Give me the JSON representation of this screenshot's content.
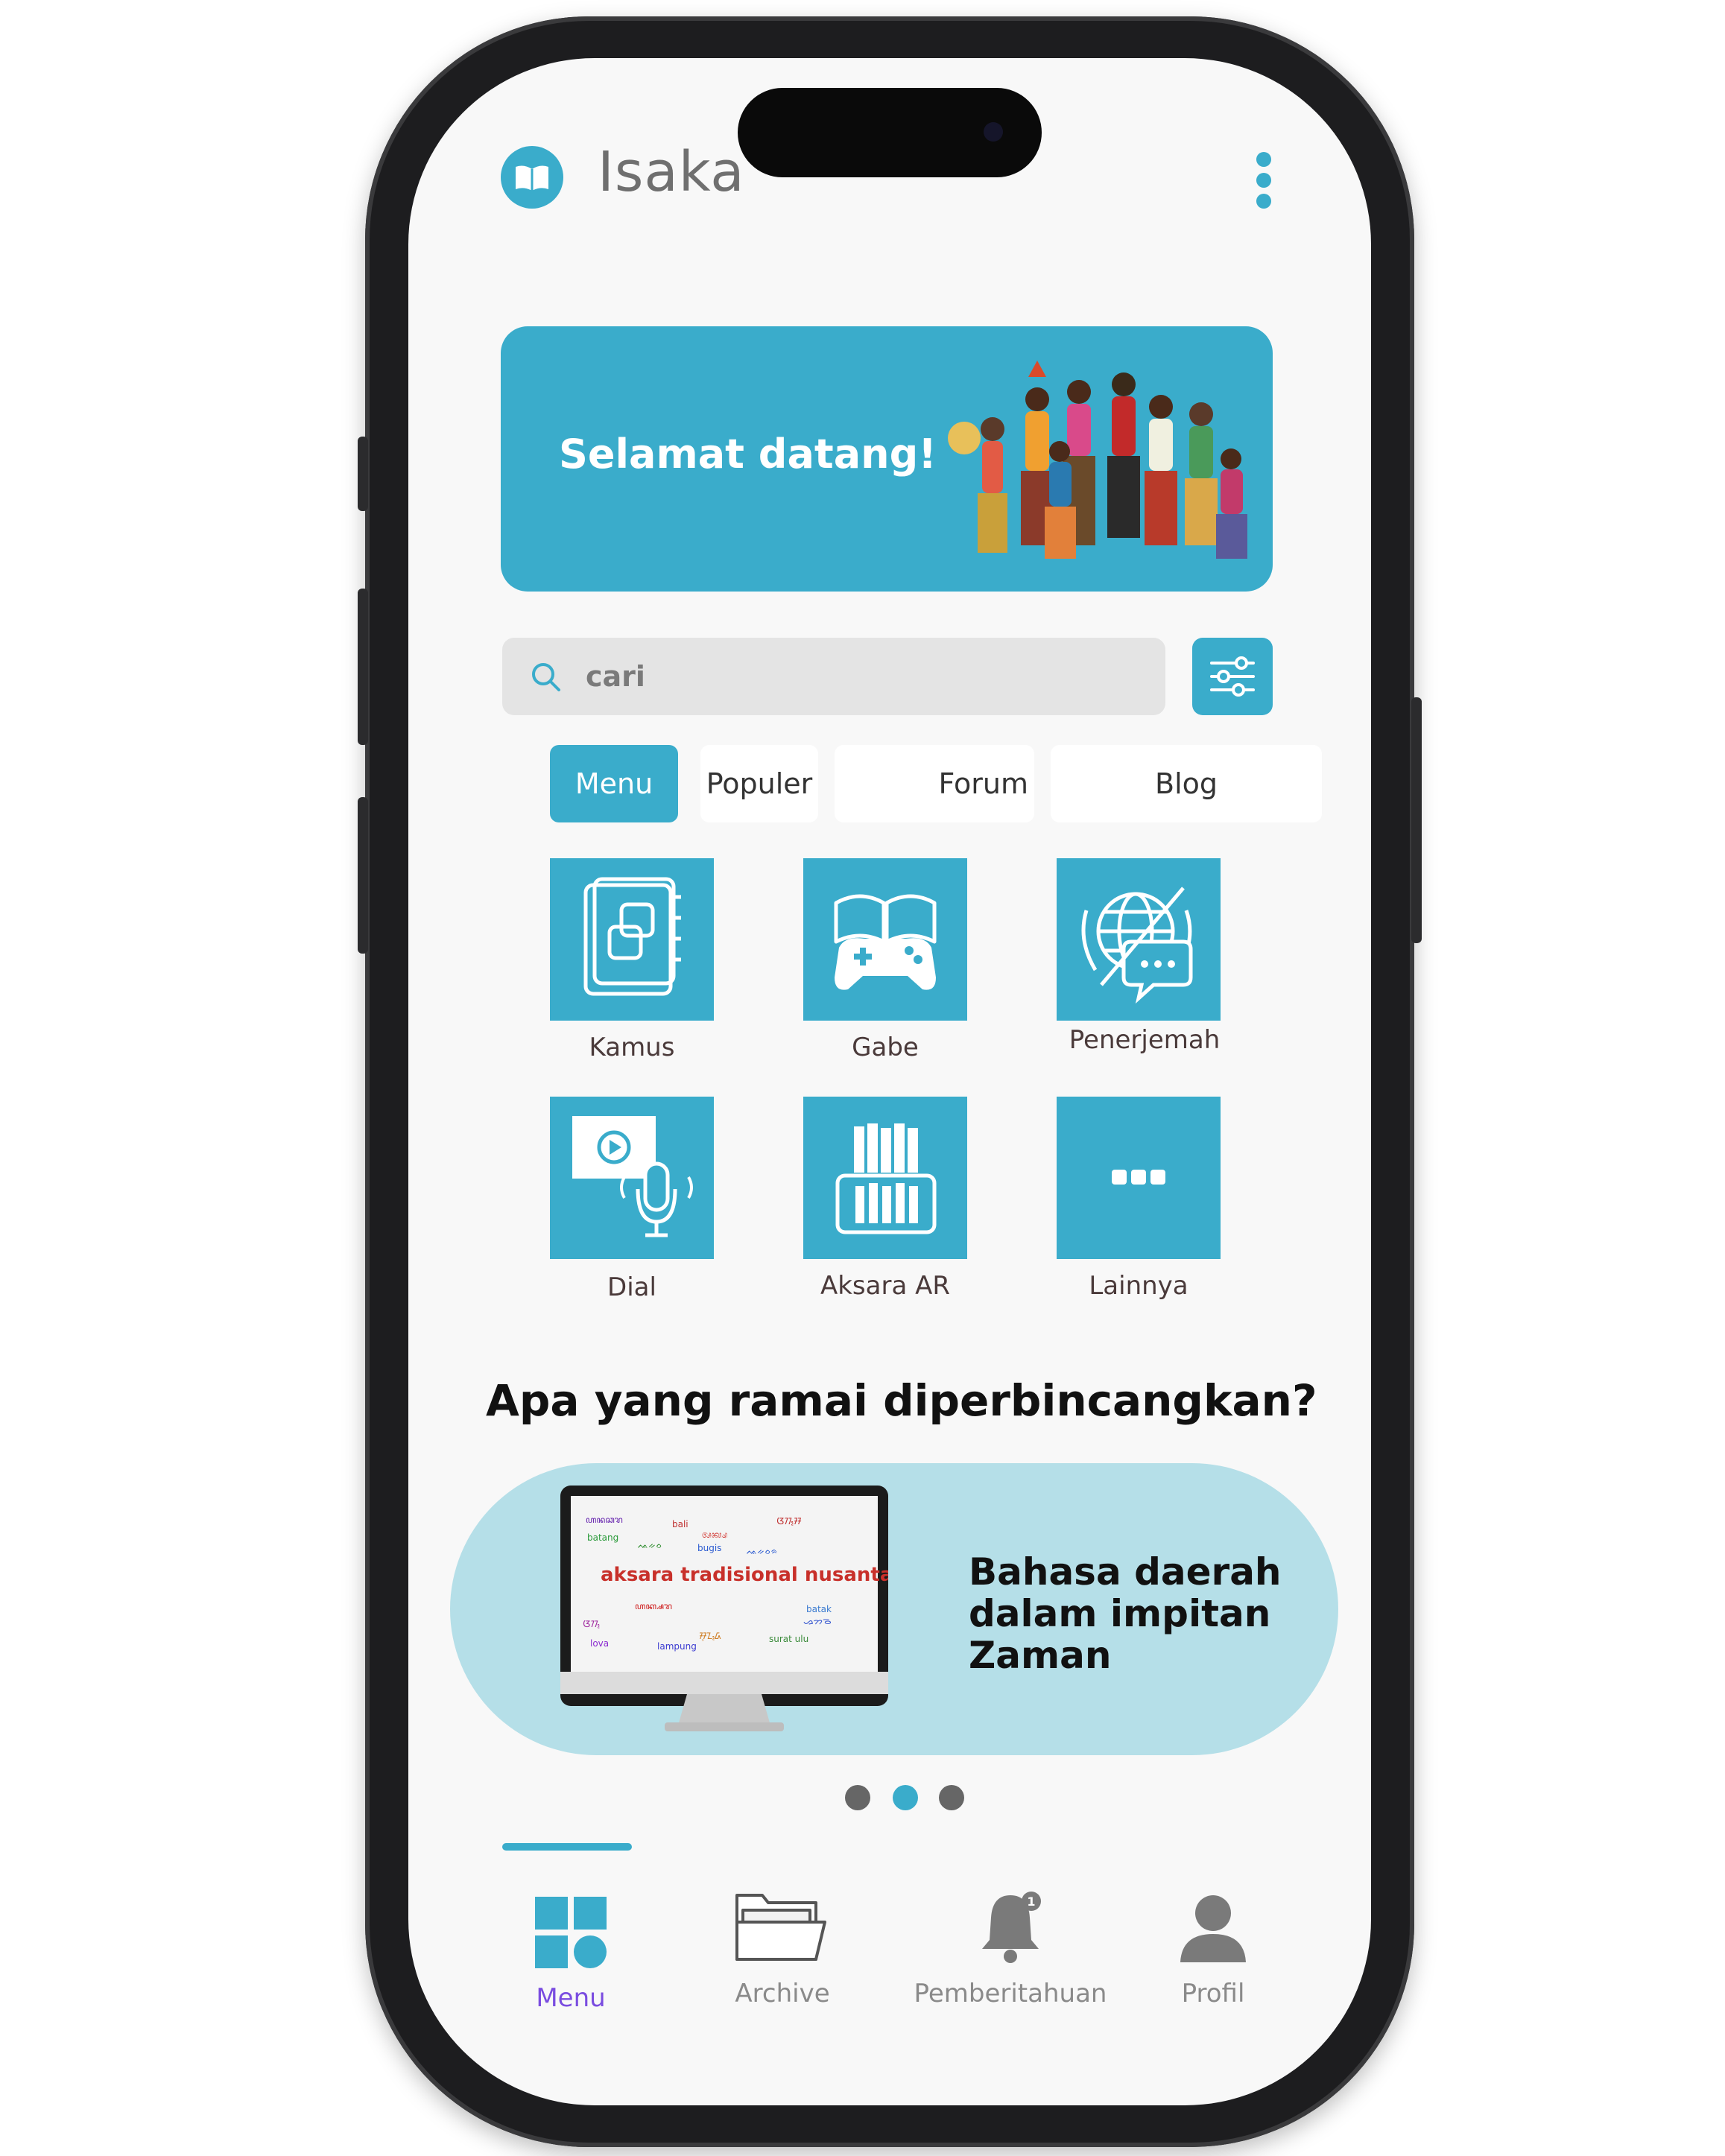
{
  "app": {
    "title": "Isaka"
  },
  "banner": {
    "greeting": "Selamat datang!"
  },
  "search": {
    "placeholder": "cari"
  },
  "tabs": [
    {
      "label": "Menu",
      "active": true
    },
    {
      "label": "Populer",
      "active": false
    },
    {
      "label": "Forum",
      "active": false
    },
    {
      "label": "Blog",
      "active": false
    }
  ],
  "menu": [
    {
      "label": "Kamus",
      "icon": "dictionary-icon"
    },
    {
      "label": "Gabe",
      "icon": "game-book-icon"
    },
    {
      "label": "Penerjemah",
      "icon": "translate-globe-icon"
    },
    {
      "label": "Dial",
      "icon": "video-microphone-icon"
    },
    {
      "label": "Aksara AR",
      "icon": "ar-phone-books-icon"
    },
    {
      "label": "Lainnya",
      "icon": "more-dots-icon"
    }
  ],
  "trending": {
    "heading": "Apa yang ramai diperbincangkan?",
    "card_title_lines": [
      "Bahasa daerah",
      "dalam impitan",
      "Zaman"
    ],
    "card_image_text": "aksara tradisional nusantara",
    "carousel": {
      "count": 3,
      "active_index": 1
    }
  },
  "bottom_nav": [
    {
      "label": "Menu",
      "icon": "grid-icon",
      "active": true
    },
    {
      "label": "Archive",
      "icon": "folder-icon",
      "active": false
    },
    {
      "label": "Pemberitahuan",
      "icon": "bell-icon",
      "active": false,
      "badge": "1"
    },
    {
      "label": "Profil",
      "icon": "user-icon",
      "active": false
    }
  ],
  "colors": {
    "accent": "#3aaccb",
    "card_bg": "#b5dfe8",
    "active_nav": "#7a4ce0"
  }
}
